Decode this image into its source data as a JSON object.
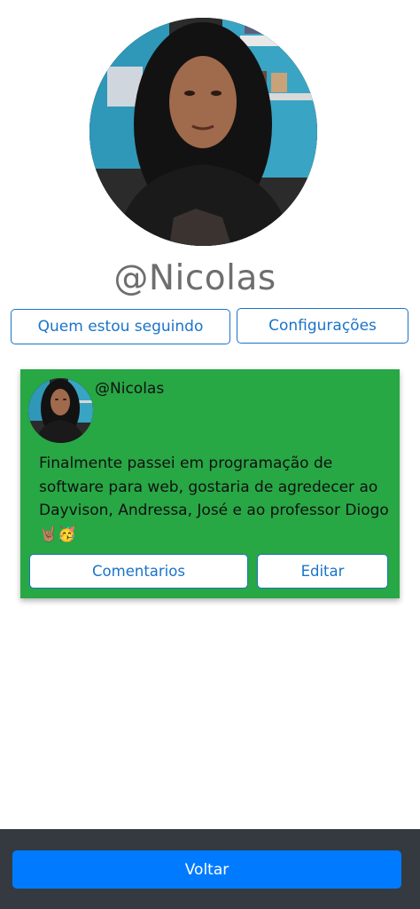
{
  "profile": {
    "username": "@Nicolas"
  },
  "actions": {
    "following_label": "Quem estou seguindo",
    "settings_label": "Configurações"
  },
  "post": {
    "author": "@Nicolas",
    "text": "Finalmente passei em programação de software para web, gostaria de agredecer ao Dayvison, Andressa, José e ao professor Diogo",
    "emojis": "🤘🏽🥳",
    "comments_label": "Comentarios",
    "edit_label": "Editar",
    "card_color": "#28a745"
  },
  "footer": {
    "back_label": "Voltar",
    "bar_color": "#343a40",
    "button_color": "#007bff"
  },
  "colors": {
    "accent": "#1a73c8",
    "username": "#6e6e6e"
  }
}
